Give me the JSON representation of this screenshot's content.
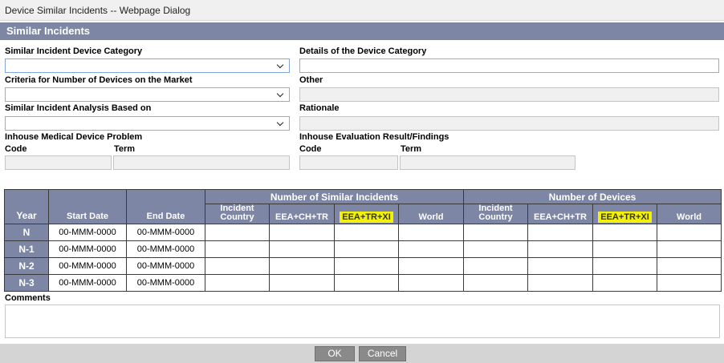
{
  "window": {
    "title": "Device Similar Incidents -- Webpage Dialog"
  },
  "section": {
    "title": "Similar Incidents"
  },
  "form": {
    "device_category_label": "Similar Incident Device Category",
    "device_category_details_label": "Details of the Device Category",
    "criteria_label": "Criteria for Number of Devices on the Market",
    "other_label": "Other",
    "analysis_label": "Similar Incident Analysis Based on",
    "rationale_label": "Rationale",
    "inhouse_problem_label": "Inhouse Medical Device Problem",
    "inhouse_eval_label": "Inhouse Evaluation Result/Findings",
    "code_label": "Code",
    "term_label": "Term"
  },
  "table": {
    "year_header": "Year",
    "start_date_header": "Start Date",
    "end_date_header": "End Date",
    "group_incidents": "Number of Similar Incidents",
    "group_devices": "Number of Devices",
    "incident_country_l1": "Incident",
    "incident_country_l2": "Country",
    "col_eea_ch_tr": "EEA+CH+TR",
    "col_eea_tr_xi": "EEA+TR+XI",
    "col_world": "World",
    "rows": [
      {
        "year": "N",
        "start": "00-MMM-0000",
        "end": "00-MMM-0000"
      },
      {
        "year": "N-1",
        "start": "00-MMM-0000",
        "end": "00-MMM-0000"
      },
      {
        "year": "N-2",
        "start": "00-MMM-0000",
        "end": "00-MMM-0000"
      },
      {
        "year": "N-3",
        "start": "00-MMM-0000",
        "end": "00-MMM-0000"
      }
    ]
  },
  "comments": {
    "label": "Comments"
  },
  "buttons": {
    "ok": "OK",
    "cancel": "Cancel"
  },
  "colors": {
    "header_bg": "#7d86a4",
    "highlight": "#f3f10a"
  }
}
